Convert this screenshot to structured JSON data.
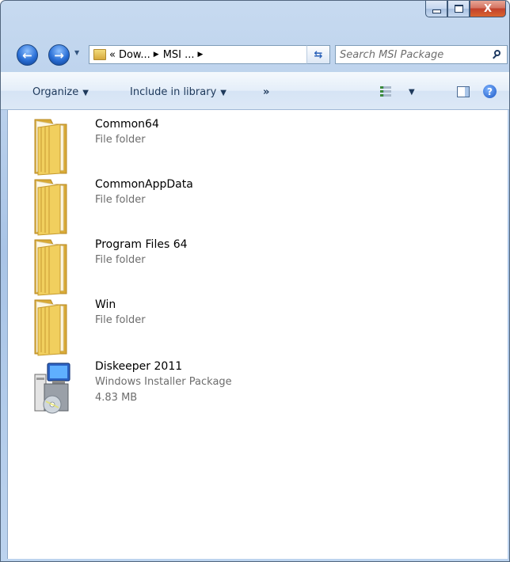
{
  "titlebar": {
    "minimize_label": "",
    "maximize_label": "",
    "close_label": "X"
  },
  "navigation": {
    "back_icon": "back-arrow-icon",
    "forward_icon": "forward-arrow-icon",
    "back_glyph": "←",
    "forward_glyph": "→"
  },
  "address": {
    "overflow": "«",
    "crumbs": [
      "Dow...",
      "MSI ..."
    ],
    "separator": "▶",
    "dropdown": "▼",
    "refresh_glyph": "⇆"
  },
  "search": {
    "placeholder": "Search MSI Package"
  },
  "commandbar": {
    "organize": "Organize",
    "include_in_library": "Include in library",
    "more": "»",
    "caret": "▼",
    "help": "?"
  },
  "items": [
    {
      "name": "Common64",
      "type": "File folder",
      "size": "",
      "icon": "folder-icon"
    },
    {
      "name": "CommonAppData",
      "type": "File folder",
      "size": "",
      "icon": "folder-icon"
    },
    {
      "name": "Program Files 64",
      "type": "File folder",
      "size": "",
      "icon": "folder-icon"
    },
    {
      "name": "Win",
      "type": "File folder",
      "size": "",
      "icon": "folder-icon"
    },
    {
      "name": "Diskeeper 2011",
      "type": "Windows Installer Package",
      "size": "4.83 MB",
      "icon": "msi-package-icon"
    }
  ],
  "colors": {
    "chrome": "#bcd3ee",
    "folder": "#e9c65a",
    "secondary_text": "#6d6d6d"
  }
}
